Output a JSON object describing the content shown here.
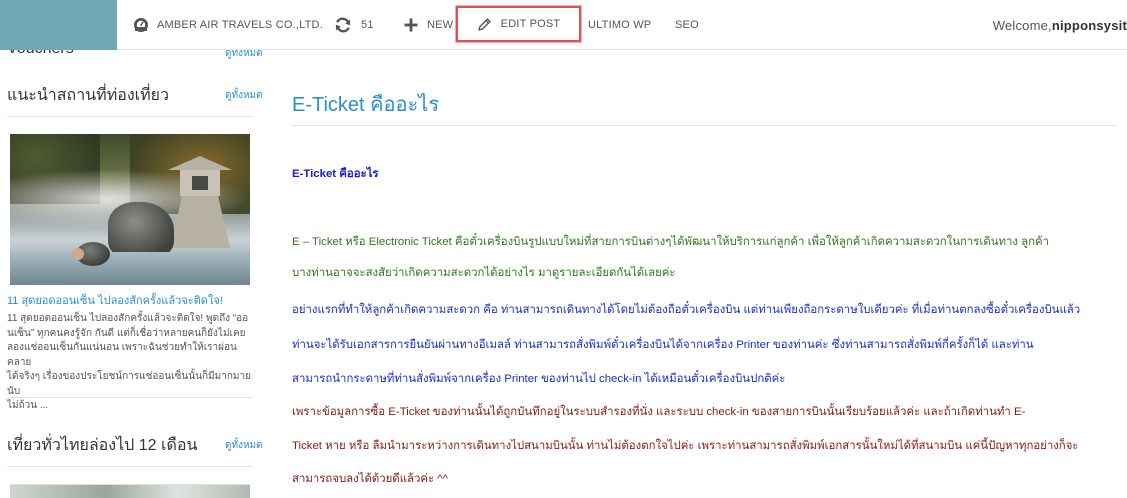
{
  "admin_bar": {
    "site_name": "AMBER AIR TRAVELS CO.,LTD.",
    "updates_count": "51",
    "new_label": "NEW",
    "edit_post_label": "EDIT POST",
    "ultimo_label": "ULTIMO WP",
    "seo_label": "SEO",
    "welcome_prefix": "Welcome, ",
    "username": "nipponsysit",
    "highlight_color": "#e05050"
  },
  "sidebar": {
    "sections": [
      {
        "heading": "Vouchers",
        "more_label": "ดูทั้งหมด"
      },
      {
        "heading": "แนะนำสถานที่ท่องเที่ยว",
        "more_label": "ดูทั้งหมด"
      },
      {
        "heading": "เที่ยวทั่วไทยล่องไป 12 เดือน",
        "more_label": "ดูทั้งหมด"
      }
    ],
    "featured_post": {
      "title": "11 สุดยอดออนเซ็น ไปลองสักครั้งแล้วจะติดใจ!",
      "excerpt": [
        "11 สุดยอดออนเซ็น ไปลองสักครั้งแล้วจะติดใจ! พูดถึง “ออ",
        "นเซ็น” ทุกคนคงรู้จัก กันดี แต่ก็เชื่อว่าหลายคนก็ยังไม่เคย",
        "ลองแช่ออนเซ็นกันแน่นอน เพราะฉันช่วยทำให้เราผ่อนคลาย",
        "ได้จริงๆ เรื่องของประโยชน์การแช่ออนเซ็นนั้นก็มีมากมายนับ",
        "ไม่ถ้วน ..."
      ]
    }
  },
  "article": {
    "title": "E-Ticket คืออะไร",
    "subheading": "E-Ticket คืออะไร",
    "lines": [
      "E – Ticket หรือ Electronic Ticket คือตั๋วเครื่องบินรูปแบบใหม่ที่สายการบินต่างๆได้พัฒนาให้บริการแก่ลูกค้า  เพื่อให้ลูกค้าเกิดความสะดวกในการเดินทาง  ลูกค้า",
      "บางท่านอาจจะสงสัยว่าเกิดความสะดวกได้อย่างไร มาดูรายละเอียดกันได้เลยค่ะ",
      "อย่างแรกที่ทำให้ลูกค้าเกิดความสะดวก คือ ท่านสามารถเดินทางได้โดยไม่ต้องถือตั๋วเครื่องบิน แต่ท่านเพียงถือกระดาษใบเดียวค่ะ ที่เมื่อท่านตกลงซื้อตั๋วเครื่องบินแล้ว",
      "ท่านจะได้รับเอกสารการยืนยันผ่านทางอีเมลล์ ท่านสามารถสั่งพิมพ์ตั๋วเครื่องบินได้จากเครื่อง Printer ของท่านค่ะ ซึ่งท่านสามารถสั่งพิมพ์กี่ครั้งก็ได้  และท่าน",
      "สามารถนำกระดาษที่ท่านสั่งพิมพ์จากเครื่อง Printer ของท่านไป check-in ได้เหมือนตั๋วเครื่องบินปกติค่ะ",
      "เพราะข้อมูลการซื้อ E-Ticket ของท่านนั้นได้ถูกบันทึกอยู่ในระบบสำรองที่นั่ง และระบบ check-in ของสายการบินนั้นเรียบร้อยแล้วค่ะ  และถ้าเกิดท่านทำ E-",
      "Ticket หาย หรือ ลืมนำมาระหว่างการเดินทางไปสนามบินนั้น ท่านไม่ต้องตกใจไปค่ะ เพราะท่านสามารถสั่งพิมพ์เอกสารนั้นใหม่ได้ที่สนามบิน แค่นี้ปัญหาทุกอย่างก็จะ",
      "สามารถจบลงได้ด้วยดีแล้วค่ะ ^^"
    ],
    "colors": {
      "link_blue": "#2a8fd0",
      "heading_blue": "#1a1ad9",
      "green": "#2d7a1a",
      "blue": "#1a2ed0",
      "maroon": "#8b1a12"
    }
  }
}
